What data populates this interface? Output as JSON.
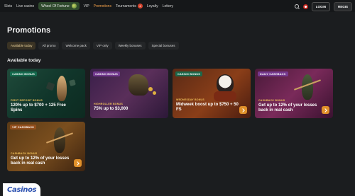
{
  "nav": {
    "items": [
      "Slots",
      "Live casino",
      "Wheel Of Fortune",
      "VIP",
      "Promotions",
      "Tournaments",
      "Loyalty",
      "Lottery"
    ],
    "active": "Promotions",
    "tournaments_badge": "4"
  },
  "header": {
    "login_label": "LOGIN",
    "register_label": "REGIS"
  },
  "page": {
    "title": "Promotions",
    "section_title": "Available today"
  },
  "filters": [
    "Available today",
    "All promo",
    "Welcome pack",
    "VIP only",
    "Weekly bonuses",
    "Special bonuses"
  ],
  "cards": [
    {
      "tag": "CASINO BONUS",
      "kicker": "FIRST DEPOSIT BONUS",
      "headline": "120% up to $700 + 125 Free Spins",
      "color": "#1f4a3a"
    },
    {
      "tag": "CASINO BONUS",
      "kicker": "HIGHROLLER BONUS",
      "headline": "75% up to $3,000",
      "color": "#5a2f5a"
    },
    {
      "tag": "CASINO BONUS",
      "kicker": "WEDNESDAY BONUS",
      "headline": "Midweek boost up to $750 + 50 FS",
      "color": "#8a3e18"
    },
    {
      "tag": "DAILY CASHBACK",
      "kicker": "CASHBACK BONUS",
      "headline": "Get up to 12% of your losses back in real cash",
      "color": "#7a2a5a"
    },
    {
      "tag": "VIP CASHBACK",
      "kicker": "CASHBACK BONUS",
      "headline": "Get up to 12% of your losses back in real cash",
      "color": "#7a4e1e"
    }
  ],
  "watermark": "Casinos"
}
